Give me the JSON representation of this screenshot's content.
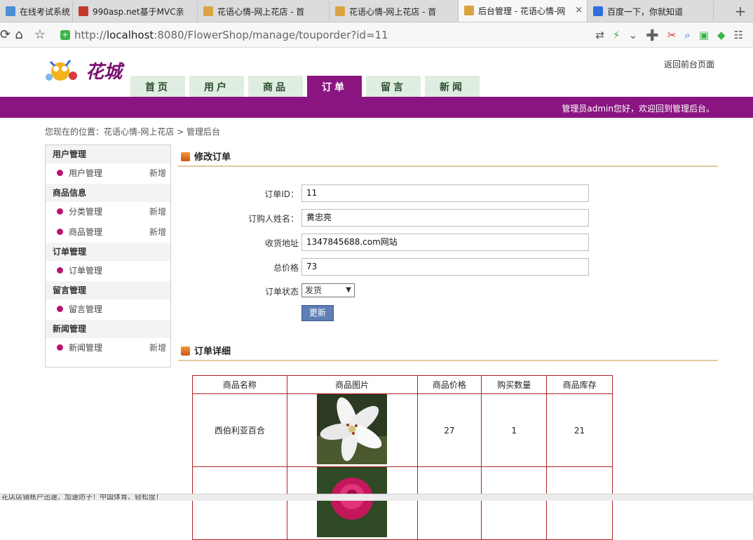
{
  "browser": {
    "tabs": [
      {
        "title": "在线考试系统",
        "fav": "#4a8fd8",
        "active": false
      },
      {
        "title": "990asp.net基于MVC亲",
        "fav": "#c0392b",
        "active": false
      },
      {
        "title": "花语心情-网上花店 - 首",
        "fav": "#d9a441",
        "active": false
      },
      {
        "title": "花语心情-网上花店 - 首",
        "fav": "#d9a441",
        "active": false
      },
      {
        "title": "后台管理 - 花语心情-网",
        "fav": "#d9a441",
        "active": true
      },
      {
        "title": "百度一下，你就知道",
        "fav": "#2f6fdc",
        "active": false
      }
    ],
    "close_glyph": "×",
    "newtab_glyph": "+",
    "url_prefix": "http://",
    "url_host": "localhost",
    "url_rest": ":8080/FlowerShop/manage/touporder?id=11"
  },
  "header": {
    "logo_text": "花城",
    "back_link": "返回前台页面",
    "nav": [
      {
        "label": "首页",
        "active": false
      },
      {
        "label": "用户",
        "active": false
      },
      {
        "label": "商品",
        "active": false
      },
      {
        "label": "订单",
        "active": true
      },
      {
        "label": "留言",
        "active": false
      },
      {
        "label": "新闻",
        "active": false
      }
    ],
    "welcome": "管理员admin您好，欢迎回到管理后台。"
  },
  "breadcrumb": "您现在的位置：花语心情-网上花店 > 管理后台",
  "sidebar": {
    "groups": [
      {
        "title": "用户管理",
        "items": [
          {
            "label": "用户管理",
            "add": "新增"
          }
        ]
      },
      {
        "title": "商品信息",
        "items": [
          {
            "label": "分类管理",
            "add": "新增"
          },
          {
            "label": "商品管理",
            "add": "新增"
          }
        ]
      },
      {
        "title": "订单管理",
        "items": [
          {
            "label": "订单管理",
            "add": ""
          }
        ]
      },
      {
        "title": "留言管理",
        "items": [
          {
            "label": "留言管理",
            "add": ""
          }
        ]
      },
      {
        "title": "新闻管理",
        "items": [
          {
            "label": "新闻管理",
            "add": "新增"
          }
        ]
      }
    ]
  },
  "edit_order": {
    "title": "修改订单",
    "fields": {
      "order_id_label": "订单ID：",
      "order_id_value": "11",
      "buyer_label": "订购人姓名：",
      "buyer_value": "黄忠亮",
      "address_label": "收货地址",
      "address_value": "1347845688.com网站",
      "total_label": "总价格",
      "total_value": "73",
      "status_label": "订单状态",
      "status_value": "发货"
    },
    "update_button": "更新"
  },
  "order_detail": {
    "title": "订单详细",
    "headers": [
      "商品名称",
      "商品图片",
      "商品价格",
      "购买数量",
      "商品库存"
    ],
    "rows": [
      {
        "name": "西伯利亚百合",
        "price": "27",
        "qty": "1",
        "stock": "21"
      },
      {
        "name": "",
        "price": "",
        "qty": "",
        "stock": ""
      }
    ]
  },
  "statusbar": "花店店铺账户迅速、加速防子！中国体育、轻松度！"
}
